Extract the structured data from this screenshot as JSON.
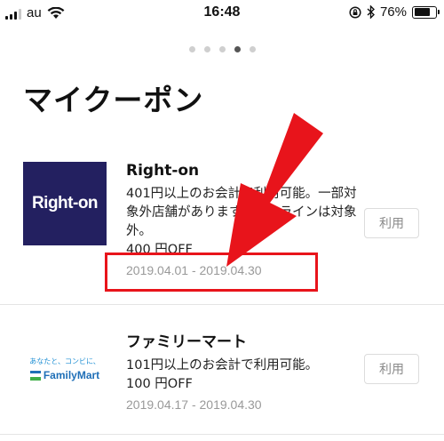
{
  "status_bar": {
    "carrier": "au",
    "time": "16:48",
    "battery": "76%",
    "battery_level": 0.76
  },
  "page_dots": {
    "count": 5,
    "active_index": 3
  },
  "title": "マイクーポン",
  "coupons": [
    {
      "name": "Right-on",
      "logo_text": "Right-on",
      "description": "401円以上のお会計で利用可能。一部対象外店舗があります。オンラインは対象外。",
      "amount": "400 円OFF",
      "period": "2019.04.01 - 2019.04.30",
      "use_label": "利用"
    },
    {
      "name": "ファミリーマート",
      "logo_tagline": "あなたと、コンビに、",
      "logo_text": "FamilyMart",
      "description": "101円以上のお会計で利用可能。",
      "amount": "100 円OFF",
      "period": "2019.04.17 - 2019.04.30",
      "use_label": "利用"
    }
  ],
  "colors": {
    "righton_bg": "#232060",
    "fm_blue": "#1f6fb7",
    "fm_green": "#3fae49",
    "annotation_red": "#e8141b"
  }
}
